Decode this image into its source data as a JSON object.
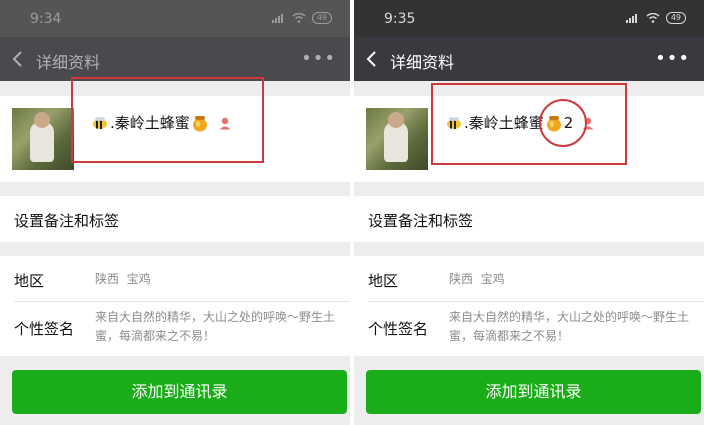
{
  "left_screen": {
    "status_time": "9:34",
    "battery": "49",
    "nav_title": "详细资料",
    "profile_name": ".秦岭土蜂蜜",
    "extra_number": "",
    "remark_label": "设置备注和标签",
    "region_label": "地区",
    "region_value": "陕西  宝鸡",
    "signature_label": "个性签名",
    "signature_value": "来自大自然的精华，大山之处的呼唤～野生土蜜，每滴都来之不易！",
    "add_button": "添加到通讯录"
  },
  "right_screen": {
    "status_time": "9:35",
    "battery": "49",
    "nav_title": "详细资料",
    "profile_name": ".秦岭土蜂蜜",
    "extra_number": "2",
    "remark_label": "设置备注和标签",
    "region_label": "地区",
    "region_value": "陕西  宝鸡",
    "signature_label": "个性签名",
    "signature_value": "来自大自然的精华，大山之处的呼唤～野生土蜜，每滴都来之不易！",
    "add_button": "添加到通讯录"
  },
  "icons": {
    "back": "chevron-left-icon",
    "more": "more-icon",
    "bee": "bee-icon",
    "honey": "honey-pot-icon",
    "gender": "gender-icon",
    "signal": "signal-icon",
    "wifi": "wifi-icon"
  },
  "colors": {
    "nav_bar": "#393a3f",
    "status_bar": "#333333",
    "primary_button": "#1aad19",
    "annotation_red": "#cc3a3e",
    "background": "#ededed"
  }
}
